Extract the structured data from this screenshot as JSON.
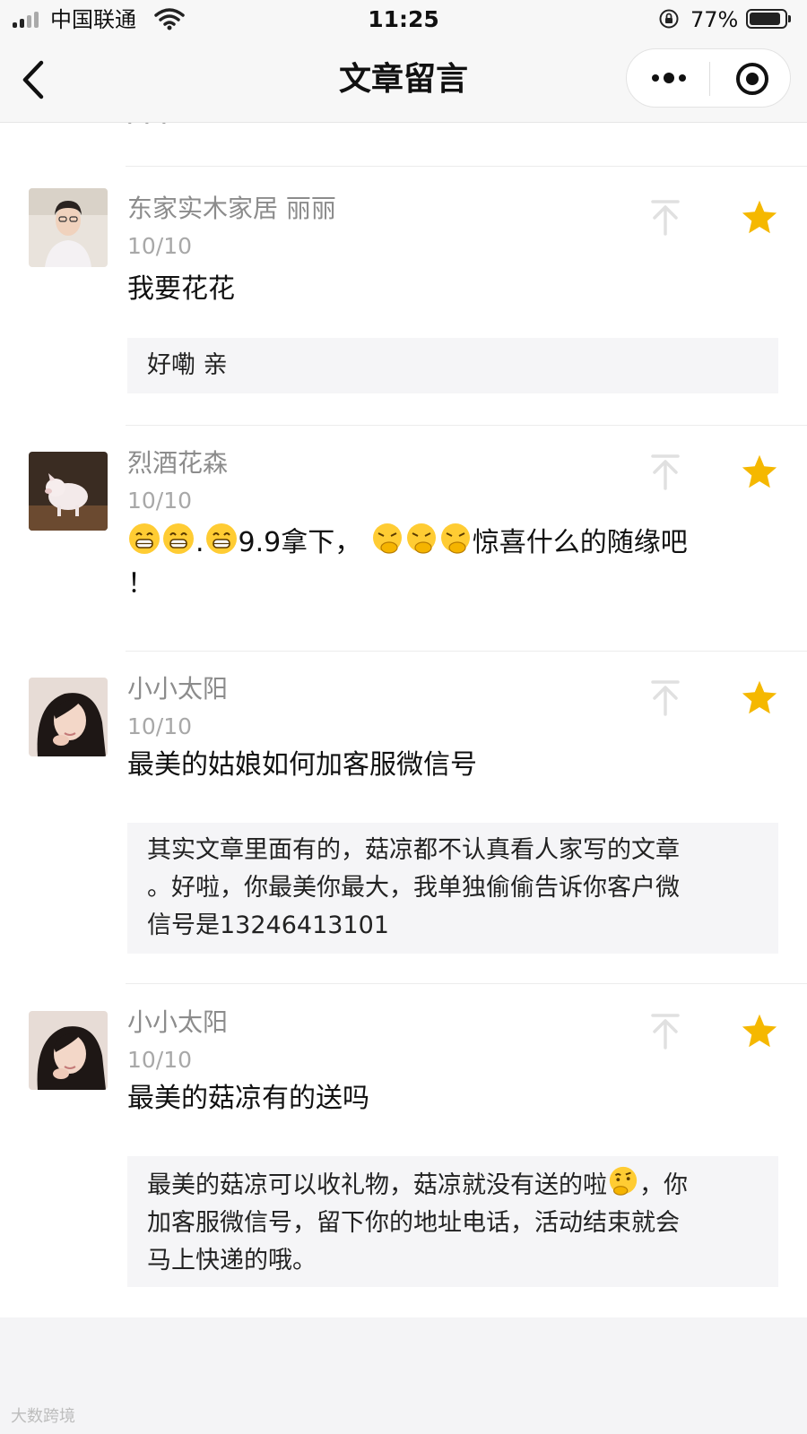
{
  "status_bar": {
    "carrier": "中国联通",
    "time": "11:25",
    "battery": "77%"
  },
  "nav": {
    "title": "文章留言"
  },
  "previous_item_tail": "·  ·  ·",
  "comments": [
    {
      "nickname": "东家实木家居 丽丽",
      "date": "10/10",
      "text": "我要花花",
      "reply": "好嘞 亲",
      "avatar": "avatar-woman-glasses"
    },
    {
      "nickname": "烈酒花森",
      "date": "10/10",
      "text_parts": [
        "",
        "",
        ".",
        "9.9拿下，",
        "",
        "",
        "",
        "惊喜什么的随缘吧"
      ],
      "text_line2": "！",
      "avatar": "avatar-pig"
    },
    {
      "nickname": "小小太阳",
      "date": "10/10",
      "text": "最美的姑娘如何加客服微信号",
      "reply_lines": [
        "其实文章里面有的，菇凉都不认真看人家写的文章",
        "。好啦，你最美你最大，我单独偷偷告诉你客户微",
        "信号是13246413101"
      ],
      "avatar": "avatar-girl"
    },
    {
      "nickname": "小小太阳",
      "date": "10/10",
      "text": "最美的菇凉有的送吗",
      "reply_lines": [
        "最美的菇凉可以收礼物，菇凉就没有送的啦",
        "，你",
        "加客服微信号，留下你的地址电话，活动结束就会",
        "马上快递的哦。"
      ],
      "avatar": "avatar-girl"
    }
  ],
  "watermark": "大数跨境",
  "colors": {
    "star": "#f5b800",
    "nav_bg": "#f7f7f7",
    "reply_bg": "#f5f5f7",
    "nickname": "#8c8c8c"
  },
  "icons": [
    "back-arrow-icon",
    "more-icon",
    "target-icon",
    "pin-top-icon",
    "star-icon",
    "grin-emoji",
    "thinking-emoji"
  ]
}
